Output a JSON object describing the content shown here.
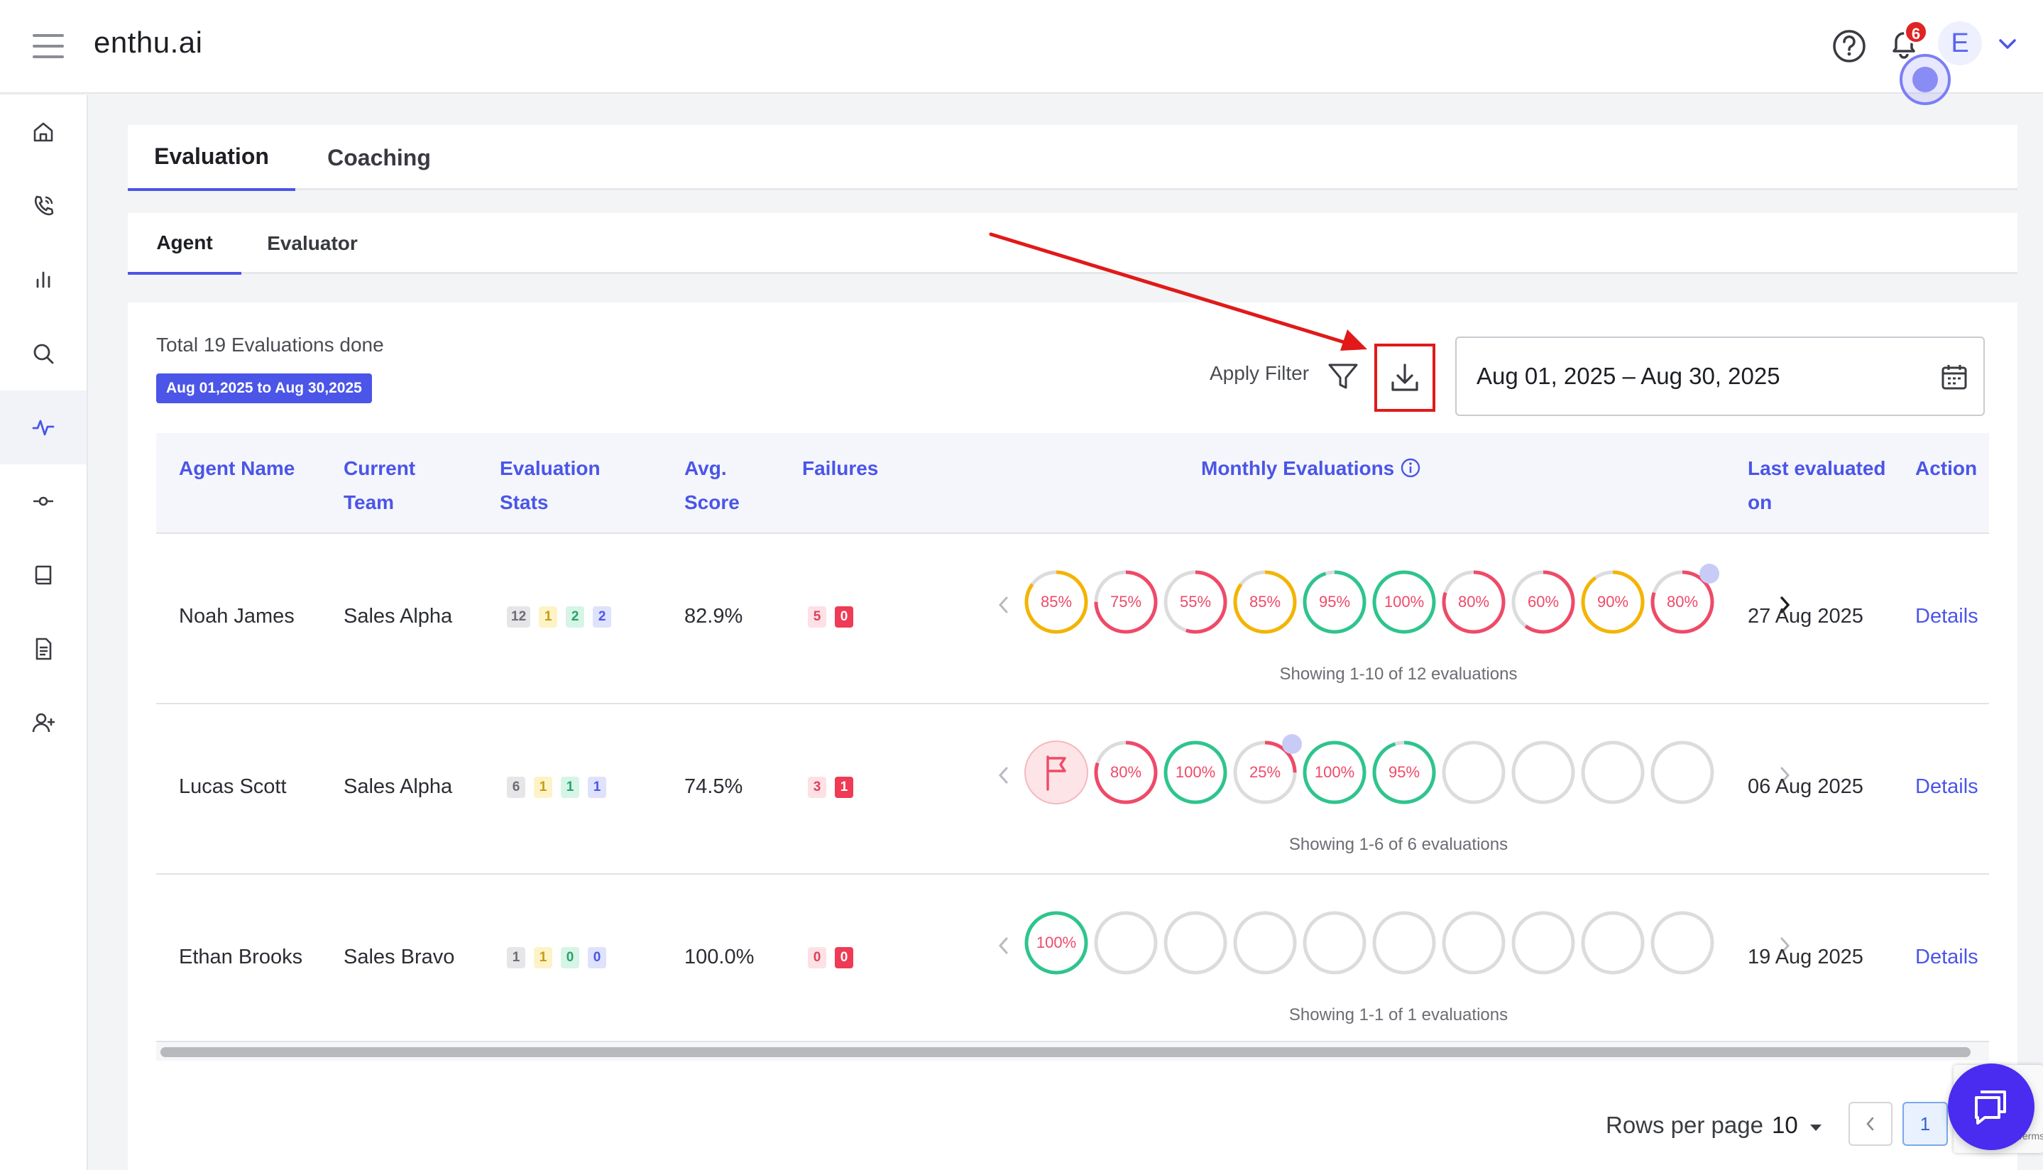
{
  "app": {
    "brand": "enthu.ai",
    "notifications_count": "6",
    "avatar_initial": "E"
  },
  "tabs": [
    {
      "label": "Evaluation"
    },
    {
      "label": "Coaching"
    }
  ],
  "subtabs": [
    {
      "label": "Agent"
    },
    {
      "label": "Evaluator"
    }
  ],
  "summary": {
    "total_text": "Total 19 Evaluations done",
    "date_chip": "Aug 01,2025 to Aug 30,2025"
  },
  "toolbar": {
    "apply_filter": "Apply Filter",
    "date_range": "Aug 01, 2025 – Aug 30, 2025"
  },
  "table": {
    "headers": {
      "agent_name": "Agent Name",
      "current_team": "Current Team",
      "evaluation_stats": "Evaluation Stats",
      "avg_score": "Avg. Score",
      "failures": "Failures",
      "monthly_evaluations": "Monthly Evaluations",
      "last_evaluated_on": "Last evaluated on",
      "action": "Action"
    },
    "rows": [
      {
        "agent": "Noah James",
        "team": "Sales Alpha",
        "stats": [
          "12",
          "1",
          "2",
          "2"
        ],
        "avg": "82.9%",
        "failures": [
          "5",
          "0"
        ],
        "evals": [
          "85%",
          "75%",
          "55%",
          "85%",
          "95%",
          "100%",
          "80%",
          "60%",
          "90%",
          "80%"
        ],
        "showing": "Showing 1-10 of 12 evaluations",
        "last": "27 Aug 2025",
        "action": "Details"
      },
      {
        "agent": "Lucas Scott",
        "team": "Sales Alpha",
        "stats": [
          "6",
          "1",
          "1",
          "1"
        ],
        "avg": "74.5%",
        "failures": [
          "3",
          "1"
        ],
        "evals": [
          "80%",
          "100%",
          "25%",
          "100%",
          "95%"
        ],
        "showing": "Showing 1-6 of 6 evaluations",
        "last": "06 Aug 2025",
        "action": "Details"
      },
      {
        "agent": "Ethan Brooks",
        "team": "Sales Bravo",
        "stats": [
          "1",
          "1",
          "0",
          "0"
        ],
        "avg": "100.0%",
        "failures": [
          "0",
          "0"
        ],
        "evals": [
          "100%"
        ],
        "showing": "Showing 1-1 of 1 evaluations",
        "last": "19 Aug 2025",
        "action": "Details"
      }
    ]
  },
  "pagination": {
    "rows_per_page_label": "Rows per page",
    "rows_per_page_value": "10",
    "current_page": "1"
  },
  "recaptcha": {
    "label": "Terms"
  },
  "colors": {
    "accent": "#4b55e8",
    "score_high": "#2fc48d",
    "score_mid": "#f4b400",
    "score_low": "#ef4a68",
    "annotation": "#e11919"
  }
}
